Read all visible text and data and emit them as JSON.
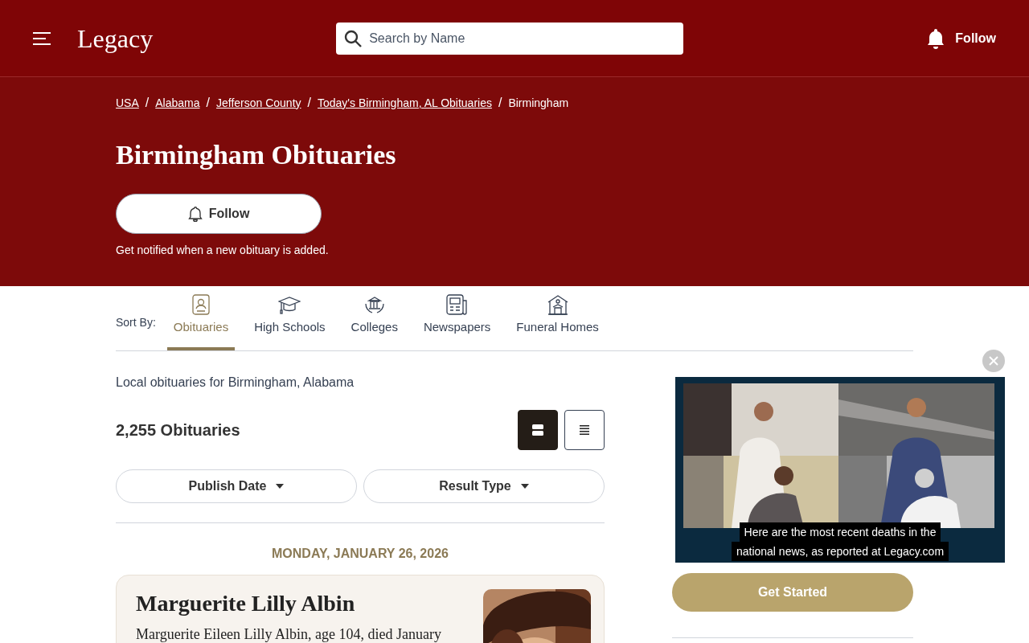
{
  "header": {
    "logo": "Legacy",
    "search": {
      "placeholder": "Search by Name"
    },
    "follow": "Follow"
  },
  "breadcrumb_separator": "/",
  "breadcrumbs": [
    {
      "label": "USA",
      "link": true
    },
    {
      "label": "Alabama",
      "link": true
    },
    {
      "label": "Jefferson County",
      "link": true
    },
    {
      "label": "Today's Birmingham, AL Obituaries",
      "link": true
    },
    {
      "label": "Birmingham",
      "link": false
    }
  ],
  "title": "Birmingham Obituaries",
  "follow_button": "Follow",
  "follow_note": "Get notified when a new obituary is added.",
  "sort_label": "Sort By:",
  "tabs": [
    {
      "label": "Obituaries",
      "kind": "person",
      "selected": true
    },
    {
      "label": "High Schools",
      "kind": "cap",
      "selected": false
    },
    {
      "label": "Colleges",
      "kind": "college",
      "selected": false
    },
    {
      "label": "Newspapers",
      "kind": "newspaper",
      "selected": false
    },
    {
      "label": "Funeral Homes",
      "kind": "home",
      "selected": false
    }
  ],
  "intro": "Local obituaries for Birmingham, Alabama",
  "count": "2,255 Obituaries",
  "view_toggle": [
    {
      "kind": "cards",
      "selected": true
    },
    {
      "kind": "list",
      "selected": false
    }
  ],
  "filters": [
    "Publish Date",
    "Result Type"
  ],
  "date_heading": "MONDAY, JANUARY 26, 2026",
  "obituary": {
    "name": "Marguerite Lilly Albin",
    "text": "Marguerite Eileen Lilly Albin, age 104, died January"
  },
  "video": {
    "caption": [
      "Here are the most recent deaths in the",
      "national news, as reported at Legacy.com"
    ]
  },
  "cta": "Get Started"
}
